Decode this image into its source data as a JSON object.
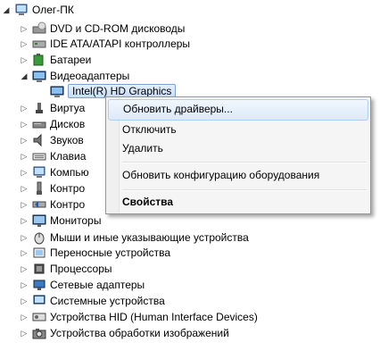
{
  "tree": {
    "root": {
      "label": "Олег-ПК",
      "icon": "computer-icon"
    },
    "items": [
      {
        "label": "DVD и CD-ROM дисководы",
        "icon": "dvd-drive-icon"
      },
      {
        "label": "IDE ATA/ATAPI контроллеры",
        "icon": "ide-controller-icon"
      },
      {
        "label": "Батареи",
        "icon": "battery-icon"
      },
      {
        "label": "Видеоадаптеры",
        "icon": "display-adapter-icon"
      },
      {
        "label": "Intel(R) HD Graphics",
        "icon": "display-adapter-icon"
      },
      {
        "label": "Виртуа",
        "icon": "virtual-device-icon"
      },
      {
        "label": "Дисков",
        "icon": "disk-drive-icon"
      },
      {
        "label": "Звуков",
        "icon": "sound-icon"
      },
      {
        "label": "Клавиа",
        "icon": "keyboard-icon"
      },
      {
        "label": "Компью",
        "icon": "computer-icon"
      },
      {
        "label": "Контро",
        "icon": "usb-controller-icon"
      },
      {
        "label": "Контро",
        "icon": "storage-controller-icon"
      },
      {
        "label": "Мониторы",
        "icon": "monitor-icon"
      },
      {
        "label": "Мыши и иные указывающие устройства",
        "icon": "mouse-icon"
      },
      {
        "label": "Переносные устройства",
        "icon": "portable-device-icon"
      },
      {
        "label": "Процессоры",
        "icon": "processor-icon"
      },
      {
        "label": "Сетевые адаптеры",
        "icon": "network-adapter-icon"
      },
      {
        "label": "Системные устройства",
        "icon": "system-device-icon"
      },
      {
        "label": "Устройства HID (Human Interface Devices)",
        "icon": "hid-icon"
      },
      {
        "label": "Устройства обработки изображений",
        "icon": "imaging-device-icon"
      }
    ]
  },
  "context_menu": {
    "items": [
      {
        "label": "Обновить драйверы..."
      },
      {
        "label": "Отключить"
      },
      {
        "label": "Удалить"
      },
      {
        "label": "Обновить конфигурацию оборудования"
      },
      {
        "label": "Свойства"
      }
    ]
  },
  "colors": {
    "highlight": "#dce9f9",
    "highlight_border": "#aecff7",
    "selection": "#c7dcf5"
  }
}
